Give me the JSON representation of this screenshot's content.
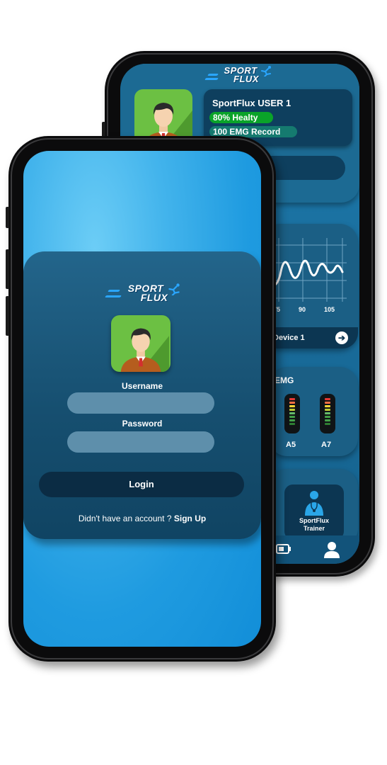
{
  "brand": {
    "line1": "SPORT",
    "line2": "FLUX"
  },
  "dashboard": {
    "user_name": "SportFlux USER 1",
    "health_text": "80% Healty",
    "emg_record_text": "100 EMG Record",
    "chart": {
      "x_ticks": [
        "75",
        "90",
        "105"
      ]
    },
    "device_label": "Device 1",
    "emg_title": "EMG",
    "sensors": [
      "A5",
      "A7"
    ],
    "trainer_label_line1": "SportFlux",
    "trainer_label_line2": "Trainer",
    "nav_icons": [
      "battery-icon",
      "user-icon"
    ]
  },
  "login": {
    "username_label": "Username",
    "password_label": "Password",
    "button_label": "Login",
    "signup_prompt": "Didn't have an account ? ",
    "signup_link": "Sign Up"
  },
  "colors": {
    "accent_green": "#0aa329",
    "avatar_green": "#6cc043",
    "dark_navy": "#0b2c44",
    "screen_blue": "#1f9be0"
  }
}
